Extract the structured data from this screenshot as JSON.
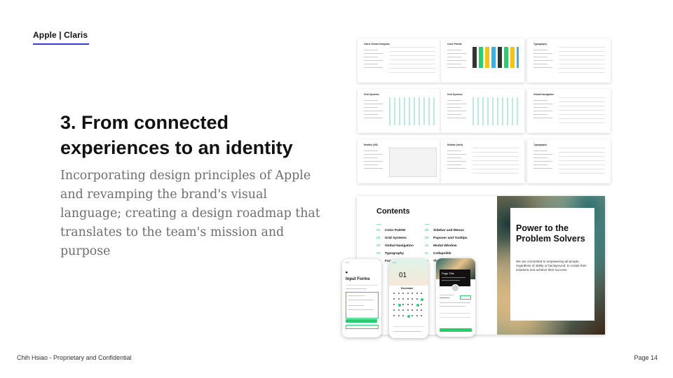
{
  "brand": "Apple | Claris",
  "title": "3. From connected experiences to an identity",
  "body": "Incorporating design principles of Apple and revamping the brand's visual language; creating a design roadmap that translates to the team's mission and purpose",
  "footer": {
    "left": "Chih Hsiao - Proprietary and Confidential",
    "right": "Page 14"
  },
  "colors": {
    "accent_rule": "#2f3fd8",
    "accent_green": "#2ecc71",
    "body_text": "#6e6e6e"
  },
  "thumbnails": [
    {
      "label": "Claris Shows Integrato"
    },
    {
      "label": "Color Palette"
    },
    {
      "label": "Typography"
    },
    {
      "label": "Grid Systems"
    },
    {
      "label": "Grid Systems"
    },
    {
      "label": "Global Navigation"
    },
    {
      "label": "Modals (4/6)"
    },
    {
      "label": "Modals (card)"
    },
    {
      "label": "Typography"
    }
  ],
  "card": {
    "contents_title": "Contents",
    "toc_left": [
      {
        "num": "01",
        "label": "Color Palette"
      },
      {
        "num": "02",
        "label": "Grid Systems"
      },
      {
        "num": "03",
        "label": "Global Navigation"
      },
      {
        "num": "04",
        "label": "Typography"
      },
      {
        "num": "05",
        "label": "Form Elements"
      }
    ],
    "toc_right": [
      {
        "num": "08",
        "label": "Sidebar and Menus"
      },
      {
        "num": "09",
        "label": "Popover and Tooltips"
      },
      {
        "num": "10",
        "label": "Modal Window"
      },
      {
        "num": "11",
        "label": "Collapsible"
      },
      {
        "num": "12",
        "label": "Thumbnails"
      }
    ],
    "art_title": "Power to the Problem Solvers",
    "art_body": "We are committed to empowering all people, regardless of ability or background, to create their solutions and achieve their success."
  },
  "phones": {
    "input_forms_title": "Input Forms",
    "calendar_day": "01",
    "calendar_month": "December",
    "page_title": "Page Title"
  }
}
